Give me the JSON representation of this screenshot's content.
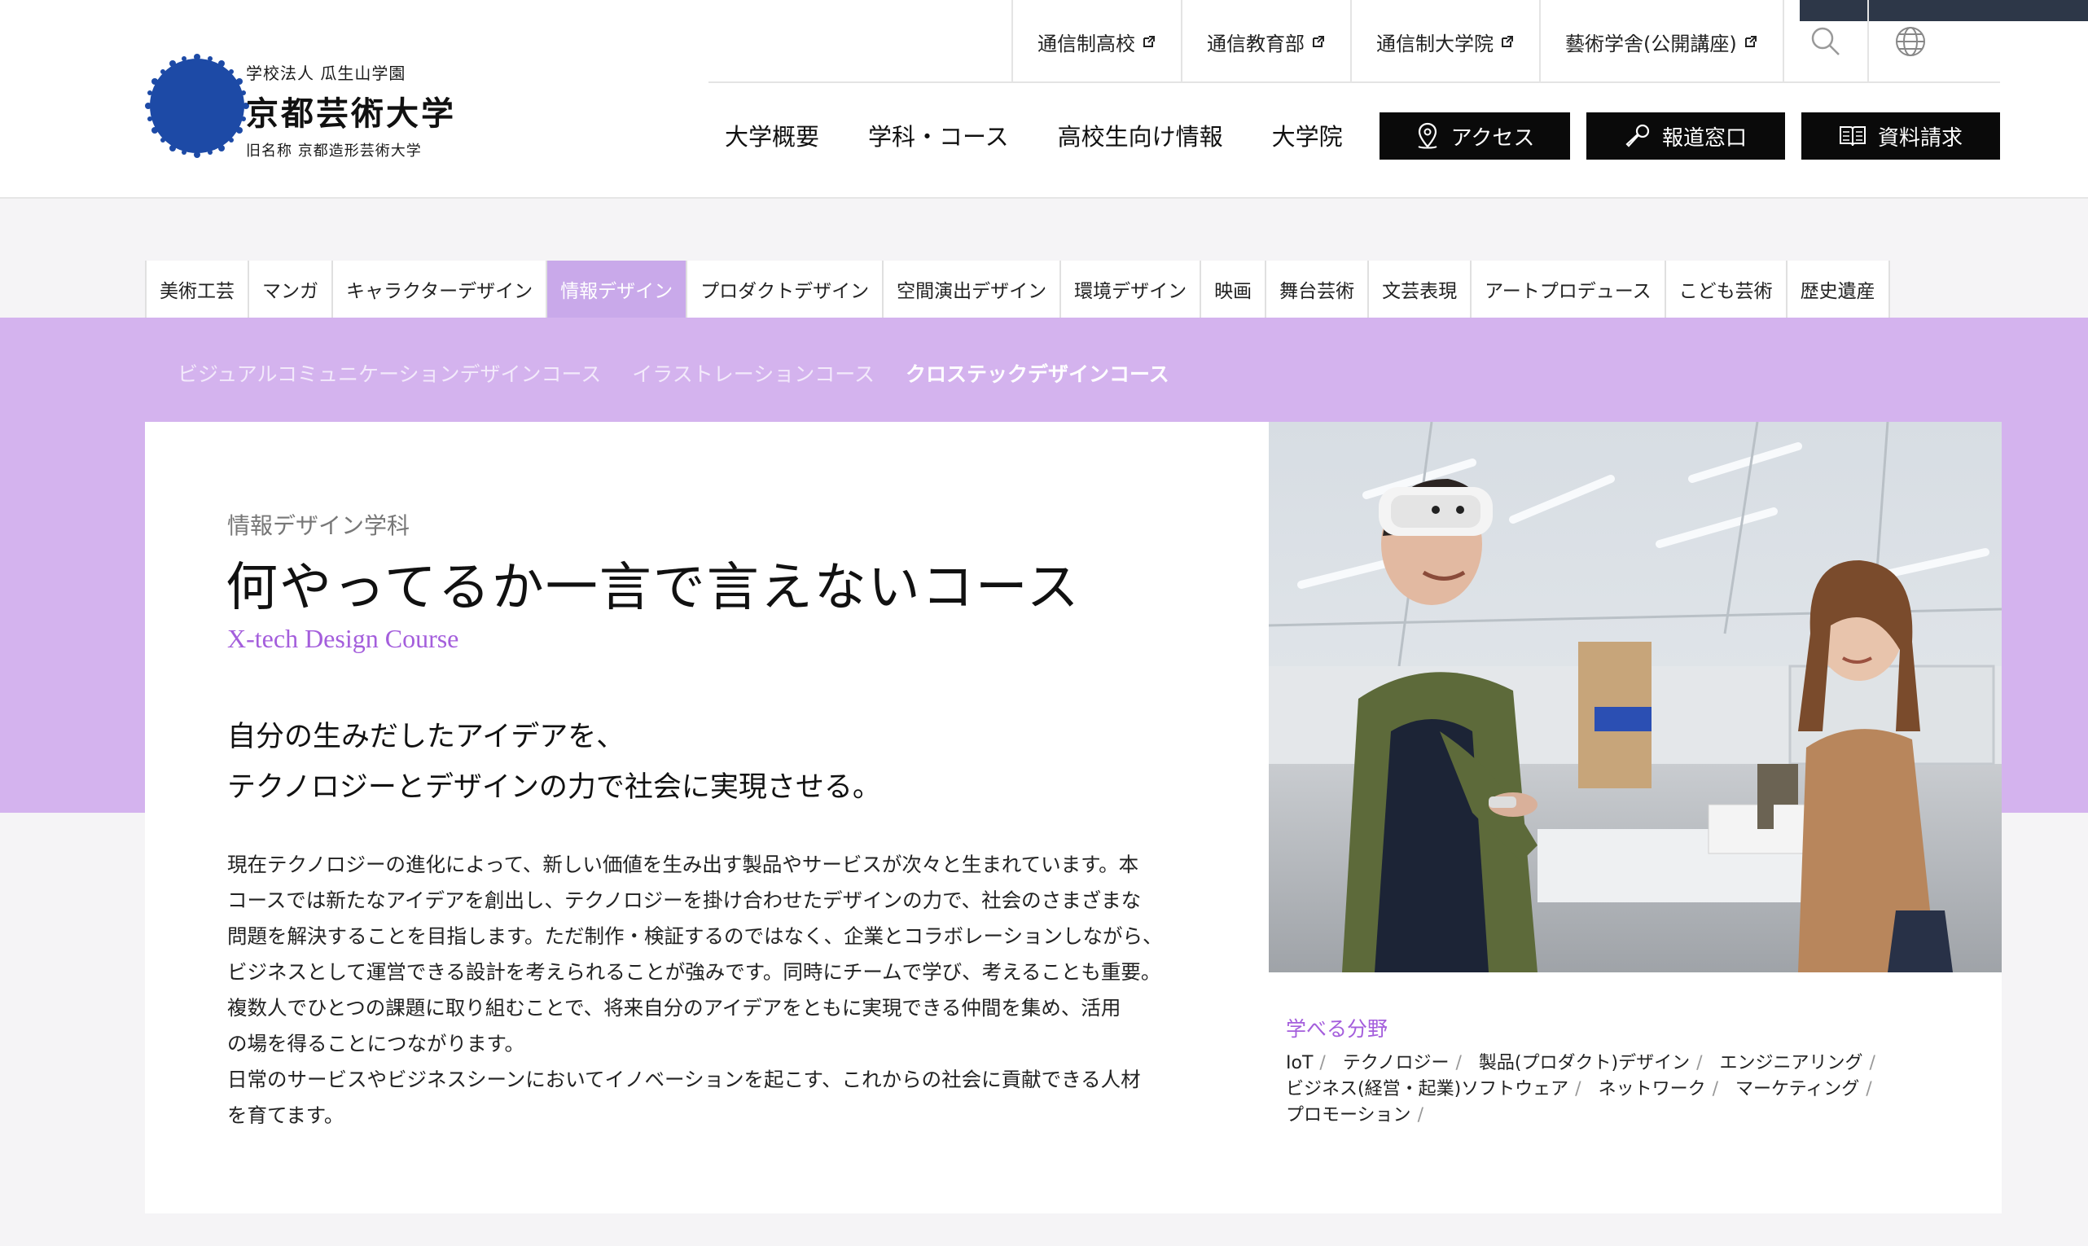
{
  "header": {
    "logo": {
      "parent_org": "学校法人 瓜生山学園",
      "name": "京都芸術大学",
      "former_name": "旧名称 京都造形芸術大学"
    },
    "utility_links": [
      {
        "label": "通信制高校",
        "icon": "external-link-icon"
      },
      {
        "label": "通信教育部",
        "icon": "external-link-icon"
      },
      {
        "label": "通信制大学院",
        "icon": "external-link-icon"
      },
      {
        "label": "藝術学舎(公開講座)",
        "icon": "external-link-icon"
      }
    ],
    "utility_icons": [
      "search-icon",
      "globe-icon"
    ],
    "main_nav": [
      "大学概要",
      "学科・コース",
      "高校生向け情報",
      "大学院"
    ],
    "cta_buttons": [
      {
        "label": "アクセス",
        "icon": "map-pin-icon"
      },
      {
        "label": "報道窓口",
        "icon": "microphone-icon"
      },
      {
        "label": "資料請求",
        "icon": "book-icon"
      }
    ]
  },
  "dept_tabs": [
    "美術工芸",
    "マンガ",
    "キャラクターデザイン",
    "情報デザイン",
    "プロダクトデザイン",
    "空間演出デザイン",
    "環境デザイン",
    "映画",
    "舞台芸術",
    "文芸表現",
    "アートプロデュース",
    "こども芸術",
    "歴史遺産"
  ],
  "dept_tabs_active": "情報デザイン",
  "course_nav": [
    "ビジュアルコミュニケーションデザインコース",
    "イラストレーションコース",
    "クロステックデザインコース"
  ],
  "course_nav_active": "クロステックデザインコース",
  "content": {
    "department": "情報デザイン学科",
    "title": "何やってるか一言で言えないコース",
    "title_en": "X-tech Design Course",
    "lead": [
      "自分の生みだしたアイデアを、",
      "テクノロジーとデザインの力で社会に実現させる。"
    ],
    "body": [
      "現在テクノロジーの進化によって、新しい価値を生み出す製品やサービスが次々と生まれています。本",
      "コースでは新たなアイデアを創出し、テクノロジーを掛け合わせたデザインの力で、社会のさまざまな",
      "問題を解決することを目指します。ただ制作・検証するのではなく、企業とコラボレーションしながら、",
      "ビジネスとして運営できる設計を考えられることが強みです。同時にチームで学び、考えることも重要。",
      "複数人でひとつの課題に取り組むことで、将来自分のアイデアをともに実現できる仲間を集め、活用",
      "の場を得ることにつながります。",
      "日常のサービスやビジネスシーンにおいてイノベーションを起こす、これからの社会に貢献できる人材",
      "を育てます。"
    ],
    "fields_title": "学べる分野",
    "fields": [
      "IoT",
      "テクノロジー",
      "製品(プロダクト)デザイン",
      "エンジニアリング",
      "ビジネス(経営・起業)ソフトウェア",
      "ネットワーク",
      "マーケティング",
      "プロモーション"
    ],
    "field_separator": "/"
  },
  "colors": {
    "accent_purple": "#d4b3ee",
    "active_tab": "#c9a9ea",
    "english_title": "#a45edc",
    "cta_bg": "#0a0a0a",
    "logo_blue": "#1d4aa6"
  }
}
